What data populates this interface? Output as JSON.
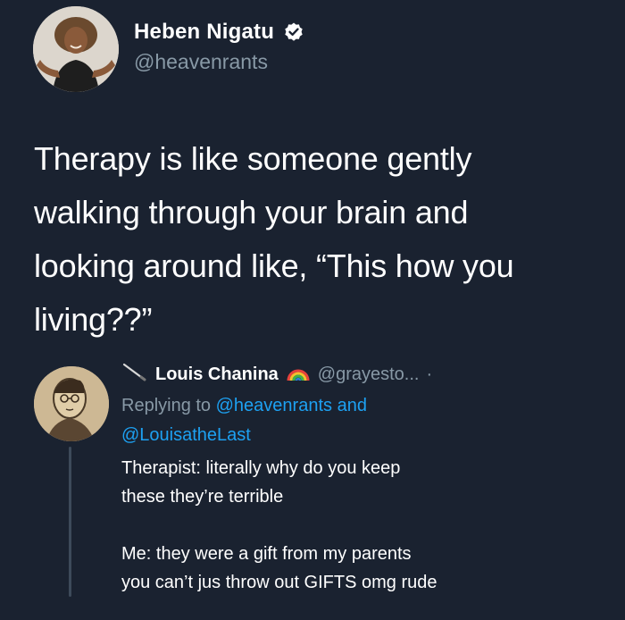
{
  "colors": {
    "background": "#1a2230",
    "name_text": "#ffffff",
    "muted_text": "#8899a6",
    "link": "#1da1f2",
    "verified": "#ffffff"
  },
  "main_tweet": {
    "display_name": "Heben Nigatu",
    "handle": "@heavenrants",
    "verified_icon": "verified-badge-icon",
    "text_lines": [
      "Therapy is like someone gently",
      "walking through your brain and",
      "looking around like, “This how you",
      "living??”"
    ]
  },
  "reply": {
    "pencil_icon": "pencil-icon",
    "display_name": "Louis Chanina",
    "rainbow_icon": "rainbow-icon",
    "handle": "@grayesto...",
    "separator": "·",
    "replying_prefix": "Replying to",
    "mention_1": "@heavenrants",
    "and_word": "and",
    "mention_2": "@LouisatheLast",
    "paragraph_1": [
      "Therapist: literally why do you keep",
      "these they’re terrible"
    ],
    "paragraph_2": [
      "Me: they were a gift from my parents",
      "you can’t jus throw out GIFTS omg rude"
    ]
  }
}
